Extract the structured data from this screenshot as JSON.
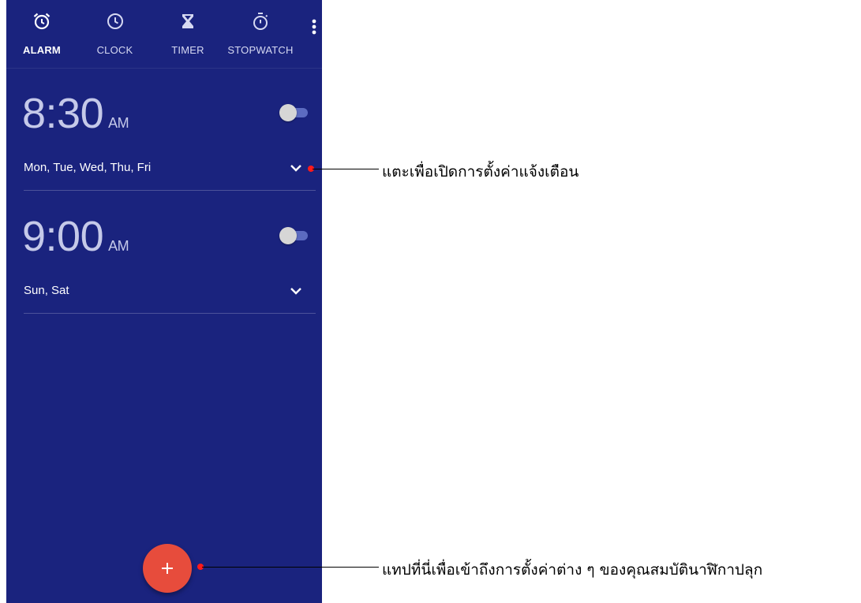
{
  "tabs": [
    {
      "label": "ALARM",
      "icon": "alarm-clock-icon",
      "active": true
    },
    {
      "label": "CLOCK",
      "icon": "clock-icon",
      "active": false
    },
    {
      "label": "TIMER",
      "icon": "hourglass-icon",
      "active": false
    },
    {
      "label": "STOPWATCH",
      "icon": "stopwatch-icon",
      "active": false
    }
  ],
  "alarms": [
    {
      "time": "8:30",
      "ampm": "AM",
      "days": "Mon, Tue, Wed, Thu, Fri",
      "enabled": false
    },
    {
      "time": "9:00",
      "ampm": "AM",
      "days": "Sun, Sat",
      "enabled": false
    }
  ],
  "fab": {
    "icon": "plus-icon"
  },
  "callouts": [
    {
      "text": "แตะเพื่อเปิดการตั้งค่าแจ้งเตือน"
    },
    {
      "text": "แทปที่นี่เพื่อเข้าถึงการตั้งค่าต่าง ๆ ของคุณสมบัตินาฬิกาปลุก"
    }
  ],
  "colors": {
    "background": "#1a237e",
    "accent": "#e74c3c",
    "callout_dot": "#ff1a1a"
  }
}
